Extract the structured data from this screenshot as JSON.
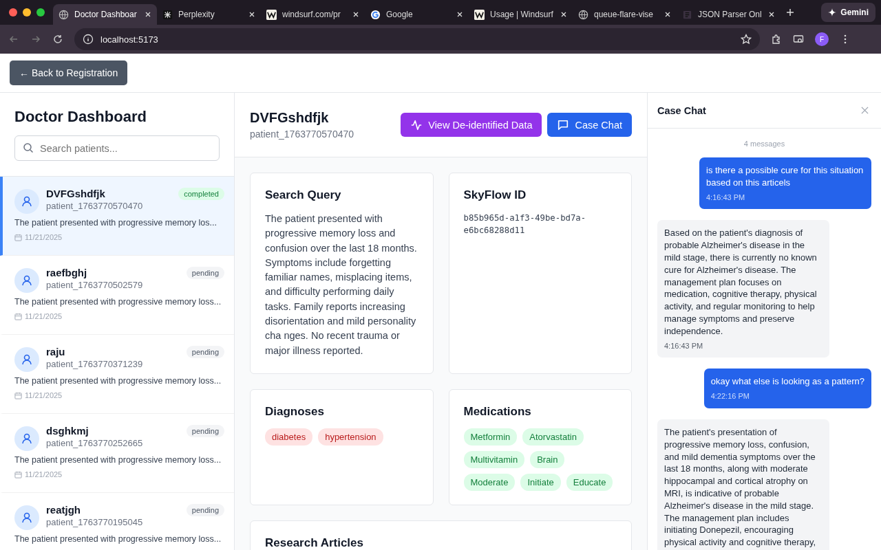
{
  "browser": {
    "tabs": [
      {
        "title": "Doctor Dashboar",
        "selected": true,
        "kind": "globe"
      },
      {
        "title": "Perplexity",
        "selected": false,
        "kind": "bug"
      },
      {
        "title": "windsurf.com/pr",
        "selected": false,
        "kind": "wave"
      },
      {
        "title": "Google",
        "selected": false,
        "kind": "google"
      },
      {
        "title": "Usage | Windsurf",
        "selected": false,
        "kind": "wave"
      },
      {
        "title": "queue-flare-vise",
        "selected": false,
        "kind": "globe"
      },
      {
        "title": "JSON Parser Onl",
        "selected": false,
        "kind": "document"
      }
    ],
    "gemini": "Gemini",
    "address": "localhost:5173",
    "profile": "F"
  },
  "topbar": {
    "back_button": "← Back to Registration"
  },
  "sidebar": {
    "title": "Doctor Dashboard",
    "search": {
      "placeholder": "Search patients..."
    },
    "patients": [
      {
        "name": "DVFGshdfjk",
        "id": "patient_1763770570470",
        "status": "completed",
        "kind": "completed",
        "selected": true,
        "summary": "The patient presented with progressive memory los...",
        "date": "11/21/2025"
      },
      {
        "name": "raefbghj",
        "id": "patient_1763770502579",
        "status": "pending",
        "kind": "pending",
        "selected": false,
        "summary": "The patient presented with progressive memory loss...",
        "date": "11/21/2025"
      },
      {
        "name": "raju",
        "id": "patient_1763770371239",
        "status": "pending",
        "kind": "pending",
        "selected": false,
        "summary": "The patient presented with progressive memory loss...",
        "date": "11/21/2025"
      },
      {
        "name": "dsghkmj",
        "id": "patient_1763770252665",
        "status": "pending",
        "kind": "pending",
        "selected": false,
        "summary": "The patient presented with progressive memory loss...",
        "date": "11/21/2025"
      },
      {
        "name": "reatjgh",
        "id": "patient_1763770195045",
        "status": "pending",
        "kind": "pending",
        "selected": false,
        "summary": "The patient presented with progressive memory loss..."
      }
    ]
  },
  "main": {
    "name": "DVFGshdfjk",
    "id": "patient_1763770570470",
    "buttons": [
      {
        "label": "View De-identified Data",
        "kind": "deidentified"
      },
      {
        "label": "Case Chat",
        "kind": "chat"
      }
    ],
    "search_query": {
      "title": "Search Query",
      "text": "The patient presented with progressive memory loss and confusion over the last 18 months. Symptoms include forgetting familiar names, misplacing items, and difficulty performing daily tasks. Family reports increasing disorientation and mild personality cha nges. No recent trauma or major illness reported."
    },
    "skyflow": {
      "title": "SkyFlow ID",
      "value": "b85b965d-a1f3-49be-bd7a-e6bc68288d11"
    },
    "diagnoses": {
      "title": "Diagnoses",
      "tags": [
        "diabetes",
        "hypertension"
      ]
    },
    "medications": {
      "title": "Medications",
      "tags": [
        "Metformin",
        "Atorvastatin",
        "Multivitamin",
        "Brain",
        "Moderate",
        "Initiate",
        "Educate"
      ]
    },
    "research": {
      "title": "Research Articles"
    }
  },
  "chat": {
    "title": "Case Chat",
    "count": "4 messages",
    "messages": [
      {
        "kind": "user",
        "text": "is there a possible cure for this situation based on this articels",
        "time": "4:16:43 PM"
      },
      {
        "kind": "assistant",
        "text": "Based on the patient's diagnosis of probable Alzheimer's disease in the mild stage, there is currently no known cure for Alzheimer's disease. The management plan focuses on medication, cognitive therapy, physical activity, and regular monitoring to help manage symptoms and preserve independence.",
        "time": "4:16:43 PM"
      },
      {
        "kind": "user",
        "text": "okay what else is looking as a pattern?",
        "time": "4:22:16 PM"
      },
      {
        "kind": "assistant",
        "text": "The patient's presentation of progressive memory loss, confusion, and mild dementia symptoms over the last 18 months, along with moderate hippocampal and cortical atrophy on MRI, is indicative of probable Alzheimer's disease in the mild stage. The management plan includes initiating Donepezil, encouraging physical activity and cognitive therapy,"
      }
    ]
  }
}
